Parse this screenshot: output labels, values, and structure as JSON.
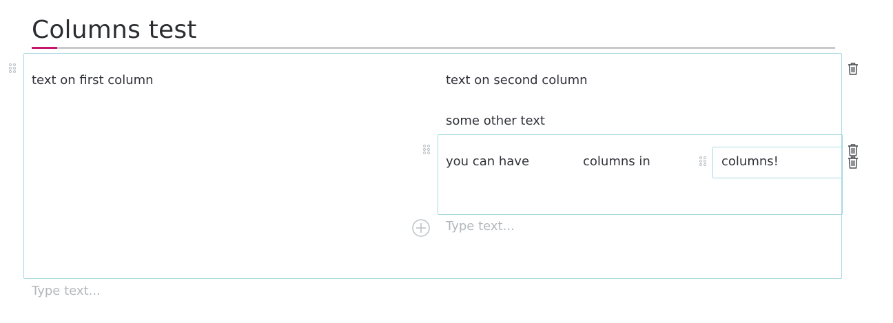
{
  "page": {
    "title": "Columns test"
  },
  "columns_block": {
    "first_column": {
      "text": "text on first column"
    },
    "second_column": {
      "paragraphs": [
        "text on second column",
        "some other text"
      ],
      "nested_columns": {
        "cells": [
          "you can have",
          "columns in",
          "columns!"
        ]
      },
      "placeholder": "Type text..."
    }
  },
  "bottom_placeholder": "Type text...",
  "icons": {
    "drag": "drag-handle-icon",
    "delete": "trash-icon",
    "add": "plus-circle-icon"
  },
  "colors": {
    "accent": "#c6166b",
    "border": "#a6d9df",
    "placeholder": "#b3b8bd"
  }
}
